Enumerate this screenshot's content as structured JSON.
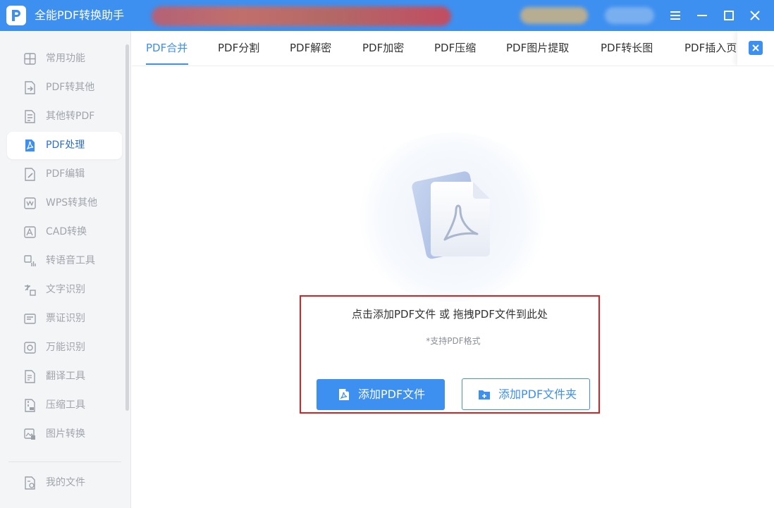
{
  "app": {
    "title": "全能PDF转换助手"
  },
  "window_controls": {
    "menu_icon": "hamburger-menu-icon",
    "minimize_icon": "minimize-icon",
    "maximize_icon": "maximize-icon",
    "close_icon": "close-icon"
  },
  "sidebar": {
    "items": [
      {
        "label": "常用功能",
        "icon": "grid-icon"
      },
      {
        "label": "PDF转其他",
        "icon": "pdf-convert-icon"
      },
      {
        "label": "其他转PDF",
        "icon": "to-pdf-icon"
      },
      {
        "label": "PDF处理",
        "icon": "pdf-process-icon",
        "active": true
      },
      {
        "label": "PDF编辑",
        "icon": "pdf-edit-icon"
      },
      {
        "label": "WPS转其他",
        "icon": "wps-icon"
      },
      {
        "label": "CAD转换",
        "icon": "cad-icon"
      },
      {
        "label": "转语音工具",
        "icon": "speech-icon"
      },
      {
        "label": "文字识别",
        "icon": "text-ocr-icon"
      },
      {
        "label": "票证识别",
        "icon": "ticket-icon"
      },
      {
        "label": "万能识别",
        "icon": "universal-ocr-icon"
      },
      {
        "label": "翻译工具",
        "icon": "translate-icon"
      },
      {
        "label": "压缩工具",
        "icon": "zip-icon"
      },
      {
        "label": "图片转换",
        "icon": "image-convert-icon"
      }
    ],
    "footer": {
      "label": "我的文件",
      "icon": "my-files-icon"
    }
  },
  "tabs": [
    {
      "label": "PDF合并",
      "active": true
    },
    {
      "label": "PDF分割"
    },
    {
      "label": "PDF解密"
    },
    {
      "label": "PDF加密"
    },
    {
      "label": "PDF压缩"
    },
    {
      "label": "PDF图片提取"
    },
    {
      "label": "PDF转长图"
    },
    {
      "label": "PDF插入页"
    }
  ],
  "main": {
    "prompt": "点击添加PDF文件 或 拖拽PDF文件到此处",
    "format_note": "*支持PDF格式",
    "add_file_button": "添加PDF文件",
    "add_folder_button": "添加PDF文件夹"
  },
  "colors": {
    "accent": "#3d8ff0",
    "sidebar_bg": "#f4f5f7",
    "highlight_border": "#e02020"
  }
}
